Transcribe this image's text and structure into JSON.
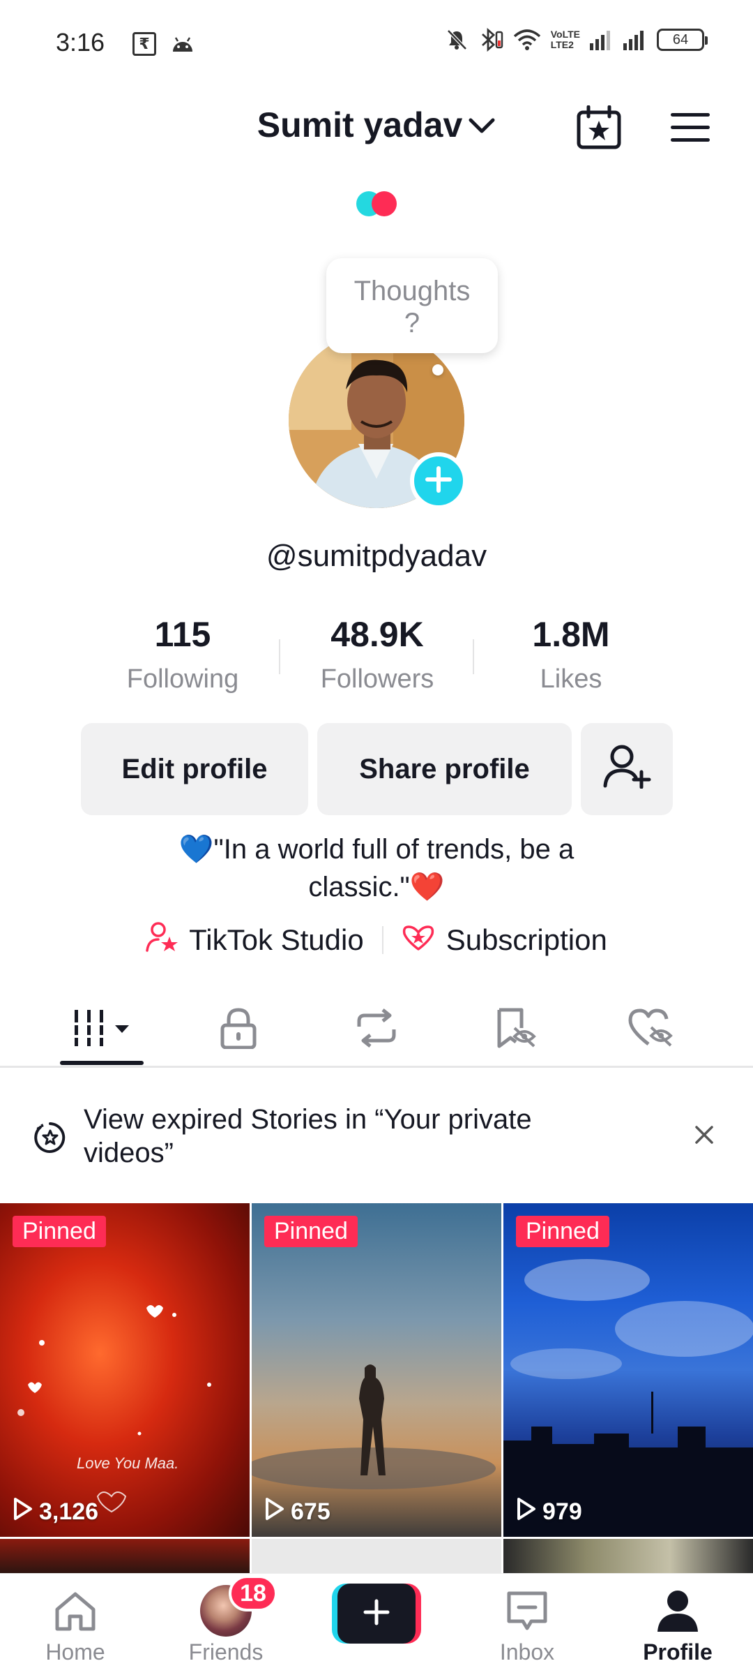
{
  "status_bar": {
    "time": "3:16",
    "rupee_symbol": "₹",
    "volte_top": "VoLTE",
    "volte_bottom": "LTE2",
    "battery": "64"
  },
  "header": {
    "username": "Sumit yadav",
    "icons": [
      "chevron-down-icon",
      "calendar-star-icon",
      "menu-icon"
    ]
  },
  "profile": {
    "thought_placeholder": "Thoughts\n?",
    "handle": "@sumitpdyadav"
  },
  "stats": [
    {
      "value": "115",
      "label": "Following"
    },
    {
      "value": "48.9K",
      "label": "Followers"
    },
    {
      "value": "1.8M",
      "label": "Likes"
    }
  ],
  "actions": {
    "edit_profile": "Edit profile",
    "share_profile": "Share profile"
  },
  "bio": {
    "line1_emoji": "💙",
    "line1_text": "\"In a world full of trends, be a",
    "line2_text": "classic.\"",
    "line2_emoji": "❤️"
  },
  "links": {
    "studio": "TikTok Studio",
    "subscription": "Subscription"
  },
  "tabs": [
    "videos-grid-icon",
    "lock-icon",
    "repost-icon",
    "saved-icon",
    "liked-icon"
  ],
  "banner": {
    "text": "View expired Stories in “Your private videos”"
  },
  "videos": [
    {
      "badge": "Pinned",
      "views": "3,126",
      "overlay": "Love You Maa."
    },
    {
      "badge": "Pinned",
      "views": "675"
    },
    {
      "badge": "Pinned",
      "views": "979"
    }
  ],
  "bottom_nav": {
    "home": "Home",
    "friends": "Friends",
    "friends_badge": "18",
    "inbox": "Inbox",
    "profile": "Profile"
  },
  "colors": {
    "accent_red": "#fe2c55",
    "accent_cyan": "#20d5ec",
    "text_primary": "#161823",
    "text_secondary": "#8a8b91"
  }
}
